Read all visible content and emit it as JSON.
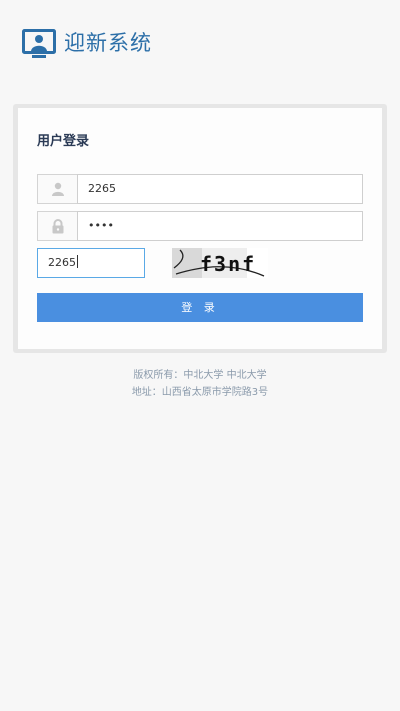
{
  "header": {
    "app_title": "迎新系统",
    "logo_icon": "monitor-user-icon",
    "brand_color": "#2c6fa8"
  },
  "login": {
    "title": "用户登录",
    "username": {
      "icon": "user-icon",
      "value": "2265"
    },
    "password": {
      "icon": "lock-icon",
      "value": "••••"
    },
    "captcha": {
      "value": "2265",
      "image_text": "f3nf"
    },
    "submit_label": "登 录",
    "accent_color": "#4a8fe0"
  },
  "footer": {
    "copyright": "版权所有：中北大学 中北大学",
    "address": "地址：山西省太原市学院路3号"
  }
}
